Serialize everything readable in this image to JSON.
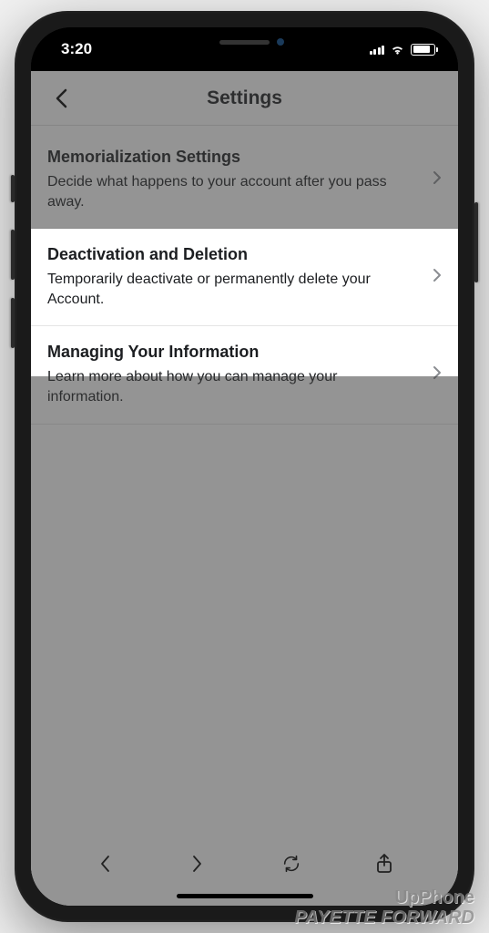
{
  "status": {
    "time": "3:20"
  },
  "nav": {
    "title": "Settings"
  },
  "items": [
    {
      "title": "Memorialization Settings",
      "desc": "Decide what happens to your account after you pass away."
    },
    {
      "title": "Deactivation and Deletion",
      "desc": "Temporarily deactivate or permanently delete your Account."
    },
    {
      "title": "Managing Your Information",
      "desc": "Learn more about how you can manage your information."
    }
  ],
  "watermark": {
    "line1": "UpPhone",
    "line2": "PAYETTE FORWARD"
  }
}
